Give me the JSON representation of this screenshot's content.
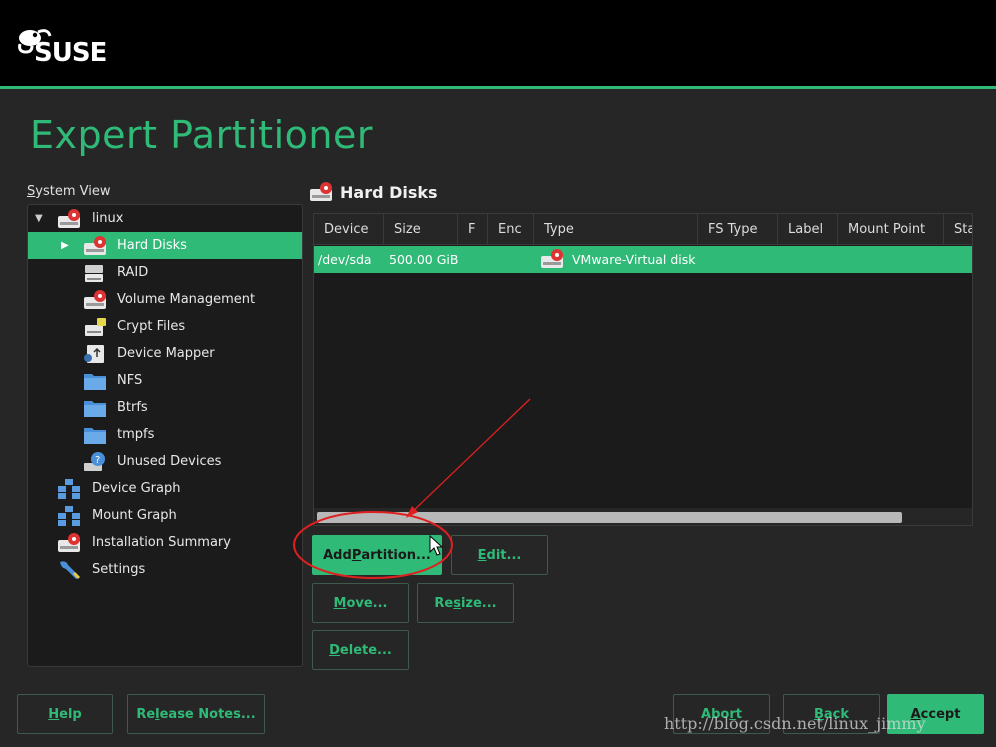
{
  "brand": {
    "logo_text": "SUSE"
  },
  "page": {
    "title": "Expert Partitioner"
  },
  "system_view": {
    "label_mnemonic": "S",
    "label_rest": "ystem View",
    "tree": [
      {
        "label": "linux",
        "icon": "hard-disk-icon",
        "expanded": true
      },
      {
        "label": "Hard Disks",
        "icon": "hard-disk-icon",
        "selected": true
      },
      {
        "label": "RAID",
        "icon": "raid-icon"
      },
      {
        "label": "Volume Management",
        "icon": "volume-management-icon"
      },
      {
        "label": "Crypt Files",
        "icon": "crypt-files-icon"
      },
      {
        "label": "Device Mapper",
        "icon": "device-mapper-icon"
      },
      {
        "label": "NFS",
        "icon": "folder-icon"
      },
      {
        "label": "Btrfs",
        "icon": "folder-icon"
      },
      {
        "label": "tmpfs",
        "icon": "folder-icon"
      },
      {
        "label": "Unused Devices",
        "icon": "unused-devices-icon"
      },
      {
        "label": "Device Graph",
        "icon": "graph-icon"
      },
      {
        "label": "Mount Graph",
        "icon": "graph-icon"
      },
      {
        "label": "Installation Summary",
        "icon": "summary-icon"
      },
      {
        "label": "Settings",
        "icon": "wrench-icon"
      }
    ]
  },
  "hard_disks": {
    "title": "Hard Disks",
    "columns": [
      "Device",
      "Size",
      "F",
      "Enc",
      "Type",
      "FS Type",
      "Label",
      "Mount Point",
      "Sta"
    ],
    "rows": [
      {
        "device": "/dev/sda",
        "size": "500.00 GiB",
        "f": "",
        "enc": "",
        "type": "VMware-Virtual disk",
        "fs_type": "",
        "label": "",
        "mount_point": ""
      }
    ]
  },
  "actions": {
    "add_partition": {
      "pre": "Add ",
      "mn": "P",
      "post": "artition..."
    },
    "edit": {
      "pre": "",
      "mn": "E",
      "post": "dit..."
    },
    "move": {
      "pre": "",
      "mn": "M",
      "post": "ove..."
    },
    "resize": {
      "pre": "Re",
      "mn": "s",
      "post": "ize..."
    },
    "delete": {
      "pre": "",
      "mn": "D",
      "post": "elete..."
    }
  },
  "footer": {
    "help": {
      "pre": "",
      "mn": "H",
      "post": "elp"
    },
    "release_notes": {
      "pre": "Re",
      "mn": "l",
      "post": "ease Notes..."
    },
    "abort": {
      "pre": "Abo",
      "mn": "r",
      "post": "t"
    },
    "back": {
      "pre": "",
      "mn": "B",
      "post": "ack"
    },
    "accept": {
      "pre": "",
      "mn": "A",
      "post": "ccept"
    }
  },
  "watermark": "http://blog.csdn.net/linux_jimmy",
  "colors": {
    "accent": "#30ba78",
    "background": "#262626",
    "annotation": "#e02020"
  }
}
